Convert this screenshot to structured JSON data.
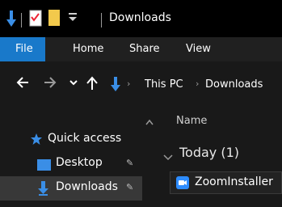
{
  "window": {
    "title": "Downloads"
  },
  "ribbon": {
    "tabs": [
      {
        "label": "File"
      },
      {
        "label": "Home"
      },
      {
        "label": "Share"
      },
      {
        "label": "View"
      }
    ]
  },
  "address": {
    "crumbs": [
      "This PC",
      "Downloads"
    ]
  },
  "nav_pane": {
    "items": [
      {
        "label": "Quick access",
        "icon": "star-icon"
      },
      {
        "label": "Desktop",
        "icon": "desktop-folder-icon",
        "pinned": true
      },
      {
        "label": "Downloads",
        "icon": "download-arrow-icon",
        "pinned": true,
        "selected": true
      }
    ]
  },
  "content": {
    "column_header": "Name",
    "groups": [
      {
        "label": "Today (1)",
        "files": [
          {
            "name": "ZoomInstaller",
            "icon": "zoom-app-icon"
          }
        ]
      }
    ]
  },
  "colors": {
    "accent": "#1979ca",
    "titlebar": "#000000",
    "background": "#191919",
    "selected": "#383838"
  }
}
